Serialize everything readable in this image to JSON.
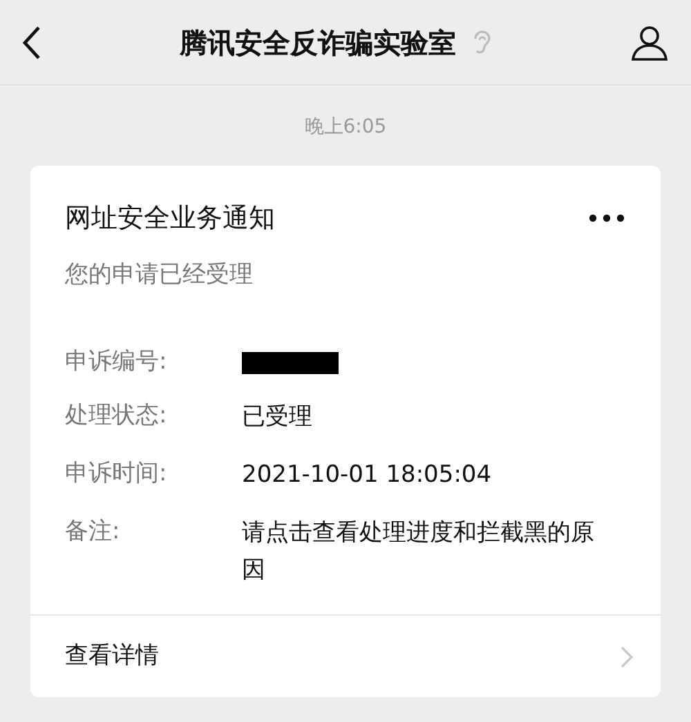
{
  "header": {
    "title": "腾讯安全反诈骗实验室"
  },
  "timestamp": "晚上6:05",
  "card": {
    "title": "网址安全业务通知",
    "subtitle": "您的申请已经受理",
    "rows": [
      {
        "kind": "redacted",
        "label": "申诉编号:"
      },
      {
        "kind": "text",
        "label": "处理状态:",
        "value": "已受理"
      },
      {
        "kind": "text",
        "label": "申诉时间:",
        "value": "2021-10-01 18:05:04"
      },
      {
        "kind": "text",
        "label": "备注:",
        "value": "请点击查看处理进度和拦截黑的原因"
      }
    ],
    "link": "查看详情"
  }
}
